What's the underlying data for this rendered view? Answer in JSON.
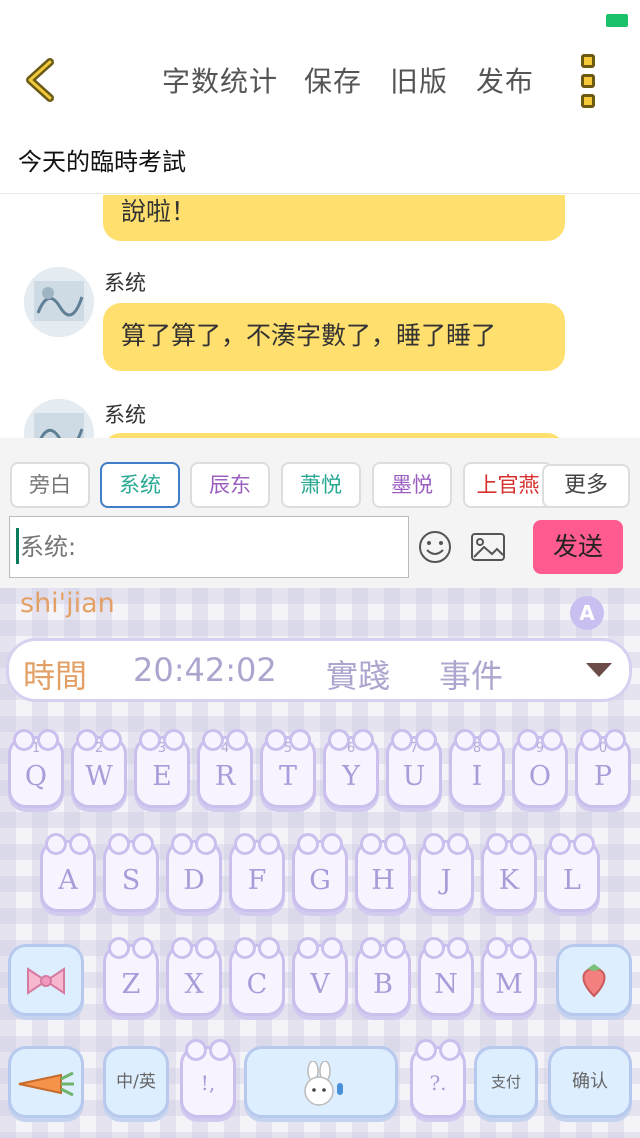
{
  "header": {
    "actions": [
      "字数统计",
      "保存",
      "旧版",
      "发布"
    ],
    "title": "今天的臨時考試"
  },
  "chat": {
    "top_bubble": "說啦！",
    "messages": [
      {
        "sender": "系统",
        "text": "算了算了，不湊字數了，睡了睡了"
      },
      {
        "sender": "系统",
        "text": ""
      }
    ]
  },
  "roles": {
    "chips": [
      {
        "label": "旁白",
        "color": "#777777",
        "selected": false
      },
      {
        "label": "系统",
        "color": "#29a894",
        "selected": true
      },
      {
        "label": "辰东",
        "color": "#9b5fc0",
        "selected": false
      },
      {
        "label": "萧悦",
        "color": "#29a894",
        "selected": false
      },
      {
        "label": "墨悦",
        "color": "#9b5fc0",
        "selected": false
      },
      {
        "label": "上官燕",
        "color": "#d8302f",
        "selected": false
      }
    ],
    "more_label": "更多"
  },
  "composer": {
    "placeholder": "系统:",
    "send_label": "发送"
  },
  "keyboard": {
    "pinyin": "shi'jian",
    "mode_label": "A",
    "candidates": [
      "時間",
      "20:42:02",
      "實踐",
      "事件"
    ],
    "row1": [
      {
        "n": "1",
        "c": "Q"
      },
      {
        "n": "2",
        "c": "W"
      },
      {
        "n": "3",
        "c": "E"
      },
      {
        "n": "4",
        "c": "R"
      },
      {
        "n": "5",
        "c": "T"
      },
      {
        "n": "6",
        "c": "Y"
      },
      {
        "n": "7",
        "c": "U"
      },
      {
        "n": "8",
        "c": "I"
      },
      {
        "n": "9",
        "c": "O"
      },
      {
        "n": "0",
        "c": "P"
      }
    ],
    "row2": [
      "A",
      "S",
      "D",
      "F",
      "G",
      "H",
      "J",
      "K",
      "L"
    ],
    "row3": [
      "Z",
      "X",
      "C",
      "V",
      "B",
      "N",
      "M"
    ],
    "lang_label": "中/英",
    "punct_label": "!,",
    "symbol_label": "?.",
    "pay_label": "支付",
    "enter_label": "确认"
  }
}
